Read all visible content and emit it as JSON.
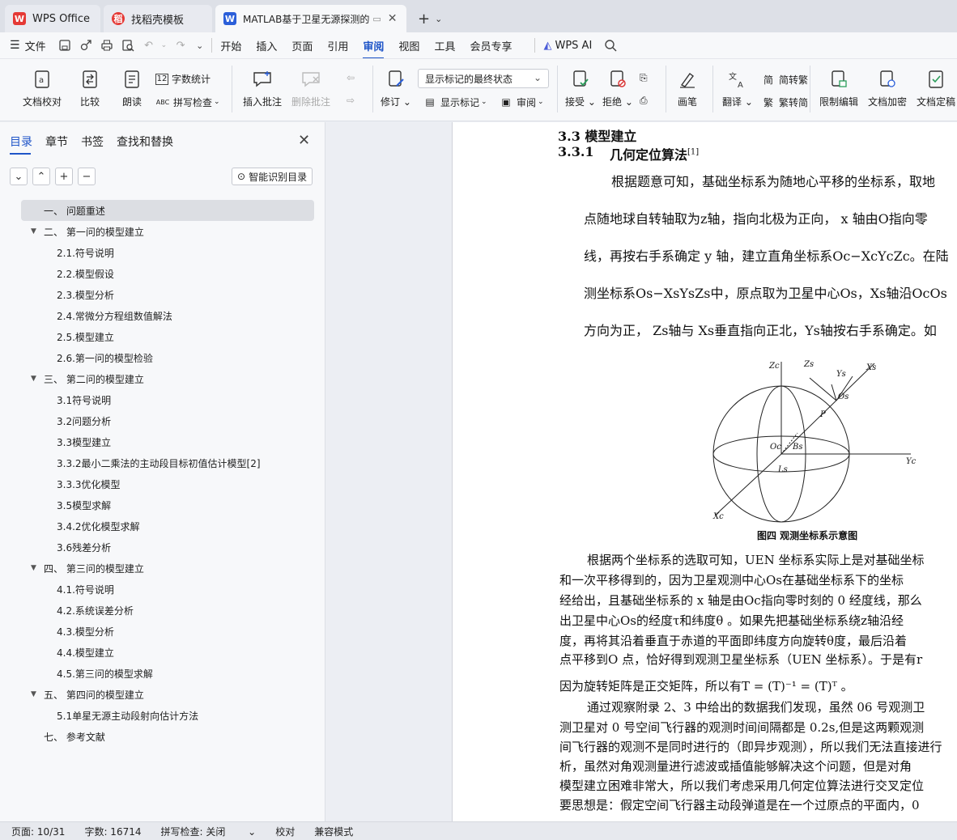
{
  "tabs": [
    {
      "label": "WPS Office",
      "active": false
    },
    {
      "label": "找稻壳模板",
      "active": false
    },
    {
      "label": "MATLAB基于卫星无源探测的",
      "active": true
    }
  ],
  "menubar": {
    "file": "文件",
    "items": [
      "开始",
      "插入",
      "页面",
      "引用",
      "审阅",
      "视图",
      "工具",
      "会员专享"
    ],
    "active": "审阅",
    "wps_ai": "WPS AI"
  },
  "ribbon": {
    "doc_check": "文档校对",
    "compare": "比较",
    "read_aloud": "朗读",
    "word_count": "字数统计",
    "spell_check": "拼写检查",
    "insert_comment": "插入批注",
    "delete_comment": "删除批注",
    "revise": "修订",
    "markup_state": "显示标记的最终状态",
    "show_markup": "显示标记",
    "review": "审阅",
    "accept": "接受",
    "reject": "拒绝",
    "pen": "画笔",
    "translate": "翻译",
    "to_traditional": "简转繁",
    "to_simplified": "繁转简",
    "restrict_edit": "限制编辑",
    "doc_encrypt": "文档加密",
    "doc_finalize": "文档定稿"
  },
  "nav": {
    "tabs": [
      "目录",
      "章节",
      "书签",
      "查找和替换"
    ],
    "smart_toc": "智能识别目录",
    "toc": [
      {
        "level": 1,
        "text": "一、 问题重述",
        "selected": true,
        "toggle": false
      },
      {
        "level": 1,
        "text": "二、 第一问的模型建立",
        "toggle": true
      },
      {
        "level": 2,
        "text": "2.1.符号说明"
      },
      {
        "level": 2,
        "text": "2.2.模型假设"
      },
      {
        "level": 2,
        "text": "2.3.模型分析"
      },
      {
        "level": 2,
        "text": "2.4.常微分方程组数值解法"
      },
      {
        "level": 2,
        "text": "2.5.模型建立"
      },
      {
        "level": 2,
        "text": "2.6.第一问的模型检验"
      },
      {
        "level": 1,
        "text": "三、 第二问的模型建立",
        "toggle": true
      },
      {
        "level": 2,
        "text": "3.1符号说明"
      },
      {
        "level": 2,
        "text": "3.2问题分析"
      },
      {
        "level": 2,
        "text": "3.3模型建立"
      },
      {
        "level": 2,
        "text": "3.3.2最小二乘法的主动段目标初值估计模型[2]"
      },
      {
        "level": 2,
        "text": "3.3.3优化模型"
      },
      {
        "level": 2,
        "text": "3.5模型求解"
      },
      {
        "level": 2,
        "text": "3.4.2优化模型求解"
      },
      {
        "level": 2,
        "text": "3.6残差分析"
      },
      {
        "level": 1,
        "text": "四、 第三问的模型建立",
        "toggle": true
      },
      {
        "level": 2,
        "text": "4.1.符号说明"
      },
      {
        "level": 2,
        "text": "4.2.系统误差分析"
      },
      {
        "level": 2,
        "text": "4.3.模型分析"
      },
      {
        "level": 2,
        "text": "4.4.模型建立"
      },
      {
        "level": 2,
        "text": "4.5.第三问的模型求解"
      },
      {
        "level": 1,
        "text": "五、 第四问的模型建立",
        "toggle": true
      },
      {
        "level": 2,
        "text": "5.1单星无源主动段射向估计方法"
      },
      {
        "level": 1,
        "text": "七、 参考文献",
        "toggle": false
      }
    ]
  },
  "doc": {
    "h1": "3.3 模型建立",
    "h2_num": "3.3.1",
    "h2_text": "几何定位算法",
    "h2_ref": "[1]",
    "lines": [
      "根据题意可知，基础坐标系为随地心平移的坐标系，取地",
      "点随地球自转轴取为z轴，指向北极为正向， x 轴由O指向零",
      "线，再按右手系确定 y 轴，建立直角坐标系Oc−XcYcZc。在陆",
      "测坐标系Os−XsYsZs中，原点取为卫星中心Os，Xs轴沿OcOs",
      "方向为正， Zs轴与 Xs垂直指向正北，Ys轴按右手系确定。如"
    ],
    "fig_labels": [
      "Zc",
      "Zs",
      "Ys",
      "Xs",
      "Os",
      "P",
      "Oc",
      "Bs",
      "Ls",
      "Yc",
      "Xc"
    ],
    "caption": "图四 观测坐标系示意图",
    "para2": [
      "根据两个坐标系的选取可知，UEN 坐标系实际上是对基础坐标",
      "和一次平移得到的，因为卫星观测中心Os在基础坐标系下的坐标",
      "经给出，且基础坐标系的 x 轴是由Oc指向零时刻的 0 经度线，那么",
      "出卫星中心Os的经度τ和纬度θ 。如果先把基础坐标系绕z轴沿经",
      "度，再将其沿着垂直于赤道的平面即纬度方向旋转θ度，最后沿着",
      "点平移到O 点，恰好得到观测卫星坐标系（UEN 坐标系）。于是有r"
    ],
    "formula": "因为旋转矩阵是正交矩阵，所以有T = (T)⁻¹ = (T)ᵀ 。",
    "para3": [
      "通过观察附录 2、3 中给出的数据我们发现，虽然 06 号观测卫",
      "测卫星对 0 号空间飞行器的观测时间间隔都是 0.2s,但是这两颗观测",
      "间飞行器的观测不是同时进行的（即异步观测），所以我们无法直接进行",
      "析，虽然对角观测量进行滤波或插值能够解决这个问题，但是对角",
      "模型建立困难非常大，所以我们考虑采用几何定位算法进行交叉定位",
      "要思想是：假定空间飞行器主动段弹道是在一个过原点的平面内，0"
    ]
  },
  "status": {
    "page": "页面: 10/31",
    "words": "字数: 16714",
    "spell": "拼写检查: 关闭",
    "proof": "校对",
    "compat": "兼容模式"
  }
}
